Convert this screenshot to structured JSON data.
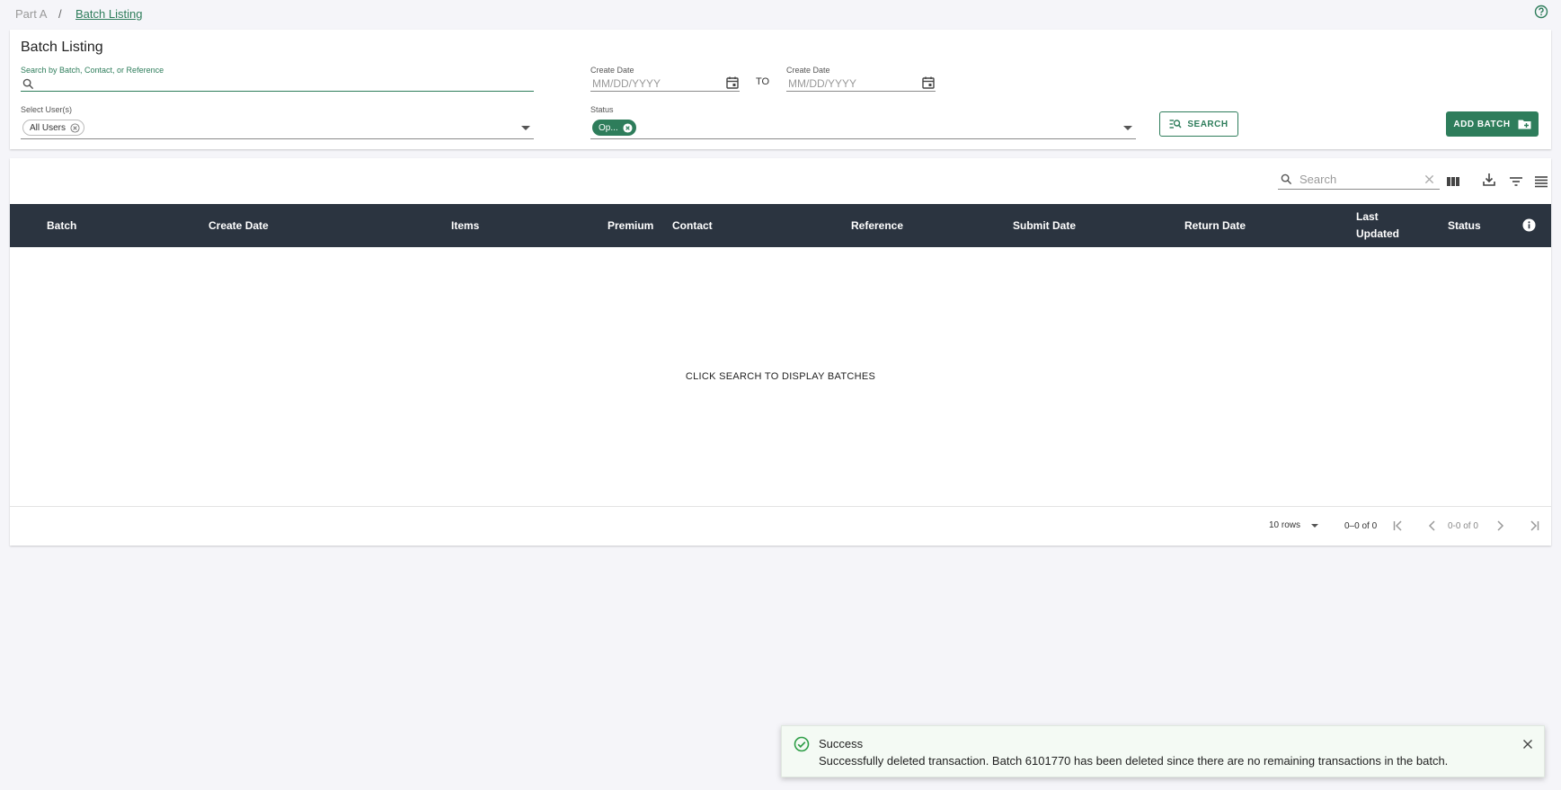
{
  "breadcrumb": {
    "parent": "Part A",
    "separator": "/",
    "current": "Batch Listing"
  },
  "filters": {
    "title": "Batch Listing",
    "search_label": "Search by Batch, Contact, or Reference",
    "search_value": "",
    "create_date_from_label": "Create Date",
    "create_date_from_placeholder": "MM/DD/YYYY",
    "to_label": "TO",
    "create_date_to_label": "Create Date",
    "create_date_to_placeholder": "MM/DD/YYYY",
    "users_label": "Select User(s)",
    "users_chip": "All Users",
    "status_label": "Status",
    "status_chip": "Op...",
    "search_button": "SEARCH",
    "add_button": "ADD BATCH"
  },
  "table": {
    "search_placeholder": "Search",
    "columns": [
      "Batch",
      "Create Date",
      "Items",
      "Premium",
      "Contact",
      "Reference",
      "Submit Date",
      "Return Date",
      "Last",
      "Updated",
      "Status"
    ],
    "empty_message": "CLICK SEARCH TO DISPLAY BATCHES",
    "rows_per_page": "10 rows",
    "range": "0–0 of 0",
    "page_of": "0-0 of 0"
  },
  "toast": {
    "title": "Success",
    "message": "Successfully deleted transaction. Batch 6101770 has been deleted since there are no remaining transactions in the batch."
  },
  "colors": {
    "accent": "#2e7d5b",
    "header_bg": "#2b3440",
    "page_bg": "#f5f5f9",
    "toast_bg": "#f4faf4"
  },
  "icons": [
    "help-icon",
    "search-icon",
    "calendar-icon",
    "chip-remove-icon",
    "dropdown-caret-icon",
    "search-list-icon",
    "folder-add-icon",
    "clear-icon",
    "columns-icon",
    "download-icon",
    "filter-icon",
    "density-icon",
    "info-icon",
    "first-page-icon",
    "prev-page-icon",
    "next-page-icon",
    "last-page-icon",
    "check-circle-icon",
    "close-icon"
  ]
}
